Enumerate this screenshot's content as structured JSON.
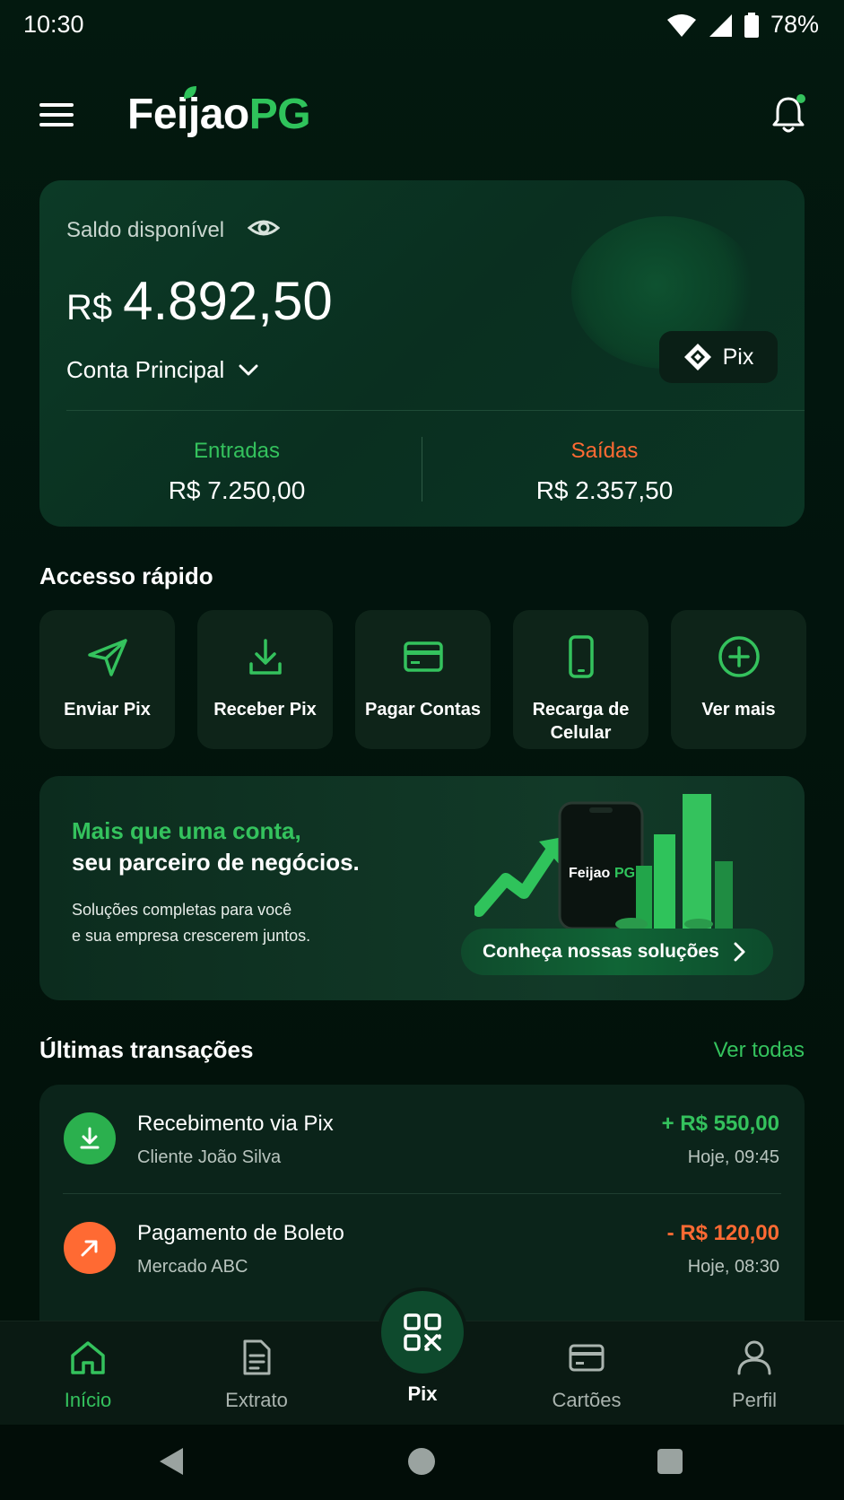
{
  "status_bar": {
    "time": "10:30",
    "battery": "78%"
  },
  "header": {
    "logo_part1": "Feijao",
    "logo_part2": "PG"
  },
  "balance": {
    "label": "Saldo disponível",
    "currency": "R$",
    "amount": "4.892,50",
    "account": "Conta Principal",
    "pix_label": "Pix",
    "income_label": "Entradas",
    "income_value": "R$ 7.250,00",
    "expense_label": "Saídas",
    "expense_value": "R$ 2.357,50"
  },
  "quick_access": {
    "title": "Accesso rápido",
    "items": [
      {
        "label": "Enviar Pix",
        "icon": "send-icon"
      },
      {
        "label": "Receber Pix",
        "icon": "download-icon"
      },
      {
        "label": "Pagar Contas",
        "icon": "card-icon"
      },
      {
        "label": "Recarga de Celular",
        "icon": "phone-icon"
      },
      {
        "label": "Ver mais",
        "icon": "plus-circle-icon"
      }
    ]
  },
  "promo": {
    "title_line1": "Mais que uma conta,",
    "title_line2": "seu parceiro de negócios.",
    "text_line1": "Soluções completas para você",
    "text_line2": "e sua empresa crescerem juntos.",
    "phone_logo_a": "Feijao",
    "phone_logo_b": "PG",
    "cta": "Conheça nossas soluções"
  },
  "transactions": {
    "title": "Últimas transações",
    "see_all": "Ver todas",
    "items": [
      {
        "name": "Recebimento via Pix",
        "sub": "Cliente João Silva",
        "amount": "+ R$ 550,00",
        "time": "Hoje, 09:45"
      },
      {
        "name": "Pagamento de Boleto",
        "sub": "Mercado ABC",
        "amount": "- R$ 120,00",
        "time": "Hoje, 08:30"
      }
    ]
  },
  "bottom_nav": {
    "items": [
      {
        "label": "Início",
        "icon": "home-icon",
        "active": true
      },
      {
        "label": "Extrato",
        "icon": "document-icon"
      },
      {
        "label": "Pix",
        "icon": "qr-code-icon"
      },
      {
        "label": "Cartões",
        "icon": "card-icon"
      },
      {
        "label": "Perfil",
        "icon": "user-icon"
      }
    ]
  },
  "colors": {
    "accent_green": "#34c25d",
    "accent_orange": "#ff6a33",
    "background": "#021510"
  }
}
